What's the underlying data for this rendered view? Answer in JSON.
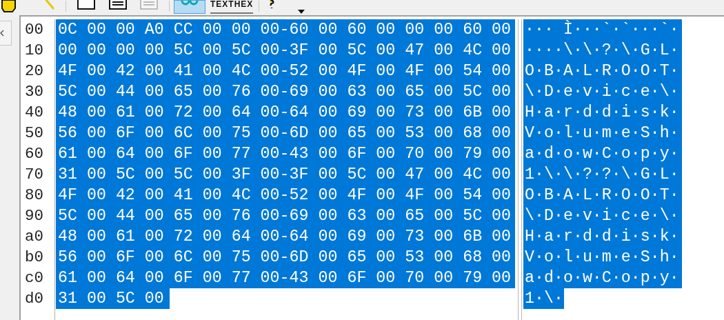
{
  "toolbar": [
    {
      "kind": "icon",
      "disabled": false,
      "pressed": false
    },
    {
      "kind": "icon",
      "disabled": false,
      "pressed": false
    },
    {
      "kind": "separator"
    },
    {
      "kind": "icon",
      "disabled": false,
      "pressed": false
    },
    {
      "kind": "icon",
      "disabled": false,
      "pressed": false
    },
    {
      "kind": "icon",
      "disabled": true,
      "pressed": false
    },
    {
      "kind": "separator"
    },
    {
      "kind": "icon",
      "disabled": false,
      "pressed": true
    },
    {
      "kind": "text",
      "label": "TEXT"
    },
    {
      "kind": "text",
      "label": "HEX"
    },
    {
      "kind": "separator"
    },
    {
      "kind": "icon",
      "disabled": false,
      "pressed": false
    },
    {
      "kind": "dropdown"
    }
  ],
  "rows": [
    {
      "address": "00",
      "hex": "0C 00 00 A0 CC 00 00 00-60 00 60 00 00 00 60 00",
      "ascii": "··· Ì···`·`···`·",
      "selected": true
    },
    {
      "address": "10",
      "hex": "00 00 00 00 5C 00 5C 00-3F 00 5C 00 47 00 4C 00",
      "ascii": "····\\·\\·?·\\·G·L·",
      "selected": true
    },
    {
      "address": "20",
      "hex": "4F 00 42 00 41 00 4C 00-52 00 4F 00 4F 00 54 00",
      "ascii": "O·B·A·L·R·O·O·T·",
      "selected": true
    },
    {
      "address": "30",
      "hex": "5C 00 44 00 65 00 76 00-69 00 63 00 65 00 5C 00",
      "ascii": "\\·D·e·v·i·c·e·\\·",
      "selected": true
    },
    {
      "address": "40",
      "hex": "48 00 61 00 72 00 64 00-64 00 69 00 73 00 6B 00",
      "ascii": "H·a·r·d·d·i·s·k·",
      "selected": true
    },
    {
      "address": "50",
      "hex": "56 00 6F 00 6C 00 75 00-6D 00 65 00 53 00 68 00",
      "ascii": "V·o·l·u·m·e·S·h·",
      "selected": true
    },
    {
      "address": "60",
      "hex": "61 00 64 00 6F 00 77 00-43 00 6F 00 70 00 79 00",
      "ascii": "a·d·o·w·C·o·p·y·",
      "selected": true
    },
    {
      "address": "70",
      "hex": "31 00 5C 00 5C 00 3F 00-3F 00 5C 00 47 00 4C 00",
      "ascii": "1·\\·\\·?·?·\\·G·L·",
      "selected": true
    },
    {
      "address": "80",
      "hex": "4F 00 42 00 41 00 4C 00-52 00 4F 00 4F 00 54 00",
      "ascii": "O·B·A·L·R·O·O·T·",
      "selected": true
    },
    {
      "address": "90",
      "hex": "5C 00 44 00 65 00 76 00-69 00 63 00 65 00 5C 00",
      "ascii": "\\·D·e·v·i·c·e·\\·",
      "selected": true
    },
    {
      "address": "a0",
      "hex": "48 00 61 00 72 00 64 00-64 00 69 00 73 00 6B 00",
      "ascii": "H·a·r·d·d·i·s·k·",
      "selected": true
    },
    {
      "address": "b0",
      "hex": "56 00 6F 00 6C 00 75 00-6D 00 65 00 53 00 68 00",
      "ascii": "V·o·l·u·m·e·S·h·",
      "selected": true
    },
    {
      "address": "c0",
      "hex": "61 00 64 00 6F 00 77 00-43 00 6F 00 70 00 79 00",
      "ascii": "a·d·o·w·C·o·p·y·",
      "selected": true
    },
    {
      "address": "d0",
      "hex": "31 00 5C 00",
      "ascii": "1·\\·",
      "selected": true
    }
  ]
}
